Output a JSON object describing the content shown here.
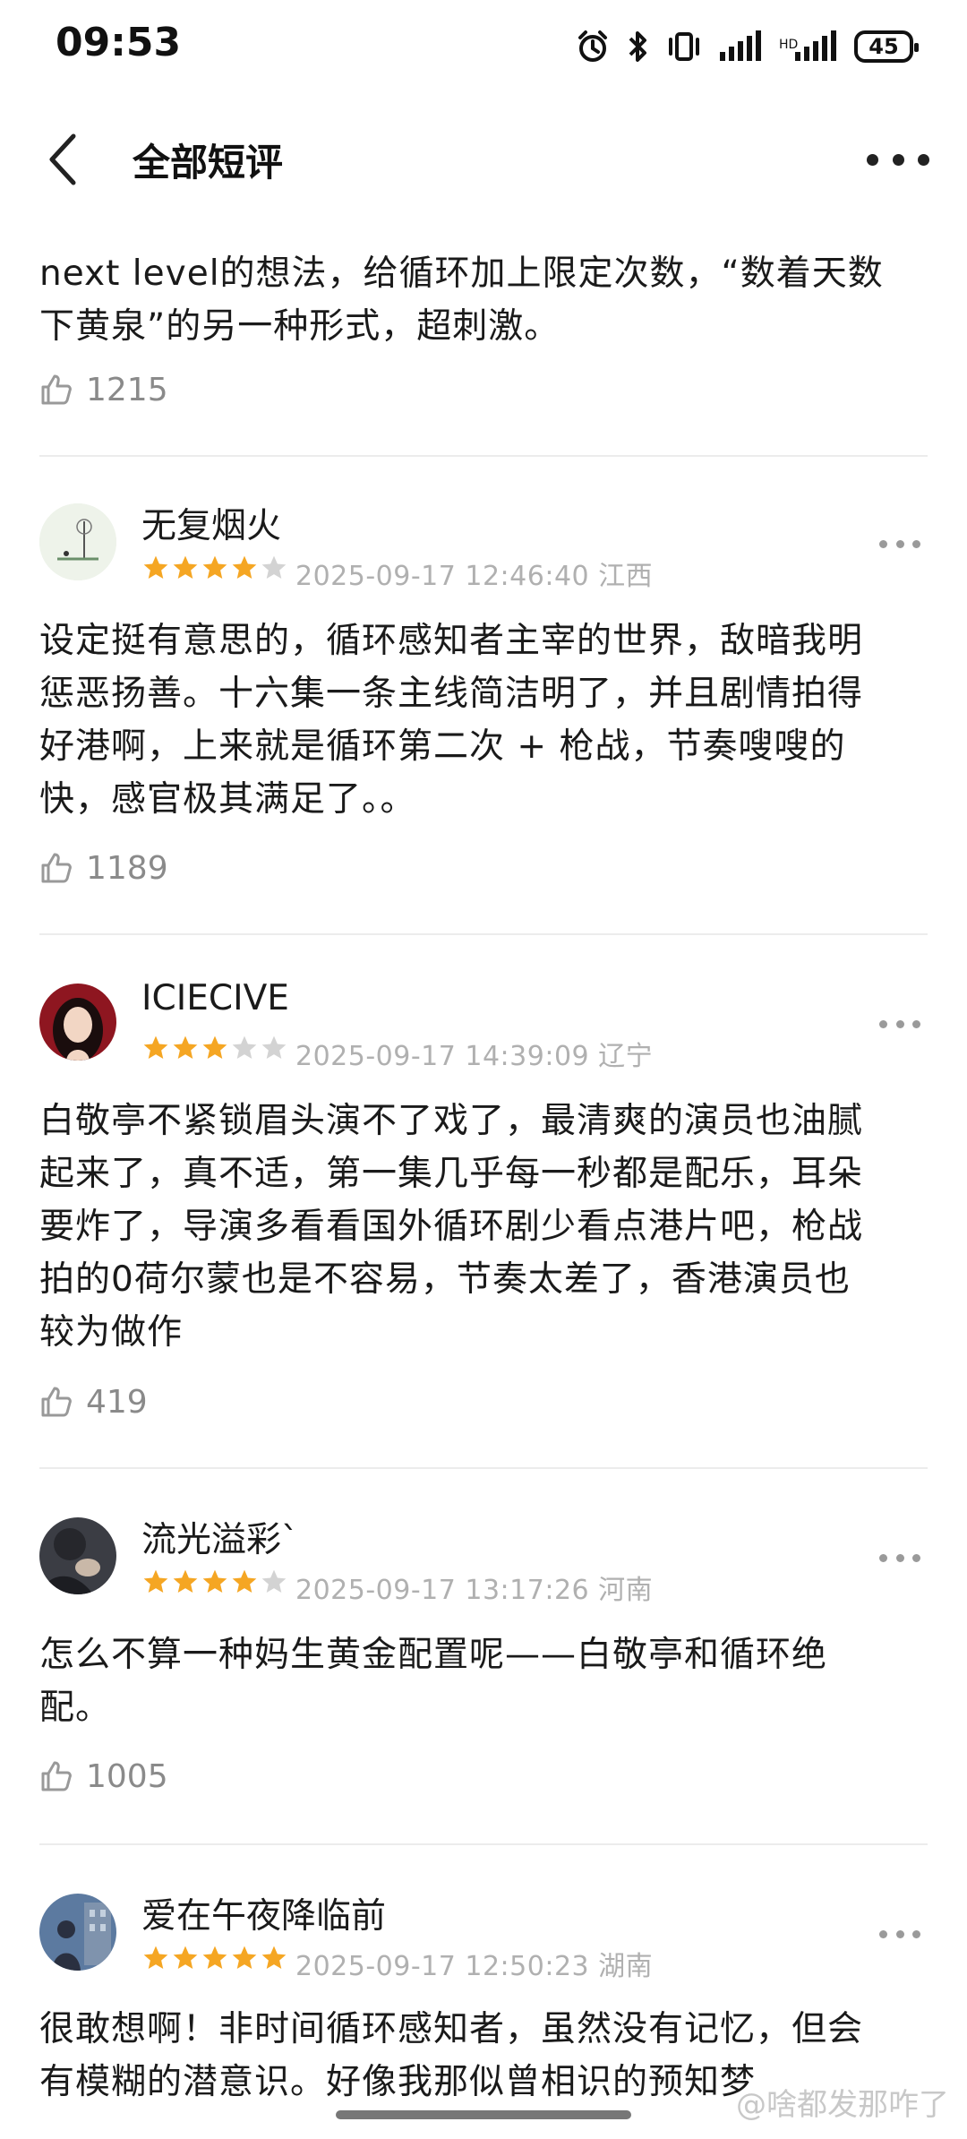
{
  "status_bar": {
    "time": "09:53",
    "battery": "45",
    "icons": [
      "alarm-icon",
      "bluetooth-icon",
      "vibrate-icon",
      "signal-icon",
      "signal-icon",
      "battery-icon"
    ]
  },
  "nav": {
    "title": "全部短评",
    "back_icon": "chevron-left-icon",
    "more_icon": "more-horizontal-icon"
  },
  "reviews": [
    {
      "text": "next level的想法，给循环加上限定次数，“数着天数\n下黄泉”的另一种形式，超刺激。",
      "likes": "1215",
      "partial": true
    },
    {
      "username": "无复烟火",
      "stars": 4,
      "meta": "2025-09-17 12:46:40 江西",
      "text": "设定挺有意思的，循环感知者主宰的世界，敌暗我明\n惩恶扬善。十六集一条主线简洁明了，并且剧情拍得\n好港啊，上来就是循环第二次 + 枪战，节奏嗖嗖的\n快，感官极其满足了。。",
      "likes": "1189"
    },
    {
      "username": "ICIECIVE",
      "stars": 3,
      "meta": "2025-09-17 14:39:09 辽宁",
      "text": "白敬亭不紧锁眉头演不了戏了，最清爽的演员也油腻\n起来了，真不适，第一集几乎每一秒都是配乐，耳朵\n要炸了，导演多看看国外循环剧少看点港片吧，枪战\n拍的0荷尔蒙也是不容易，节奏太差了，香港演员也\n较为做作",
      "likes": "419"
    },
    {
      "username": "流光溢彩`",
      "stars": 4,
      "meta": "2025-09-17 13:17:26 河南",
      "text": "怎么不算一种妈生黄金配置呢——白敬亭和循环绝\n配。",
      "likes": "1005"
    },
    {
      "username": "爱在午夜降临前",
      "stars": 5,
      "meta": "2025-09-17 12:50:23 湖南",
      "text": "很敢想啊！非时间循环感知者，虽然没有记忆，但会\n有模糊的潜意识。好像我那似曾相识的预知梦",
      "likes": ""
    }
  ],
  "watermark": "@啥都发那咋了",
  "colors": {
    "star_filled": "#F5A623",
    "star_empty": "#D3D3D3",
    "meta_text": "#B0B0B0",
    "like_text": "#8A8A8A"
  }
}
